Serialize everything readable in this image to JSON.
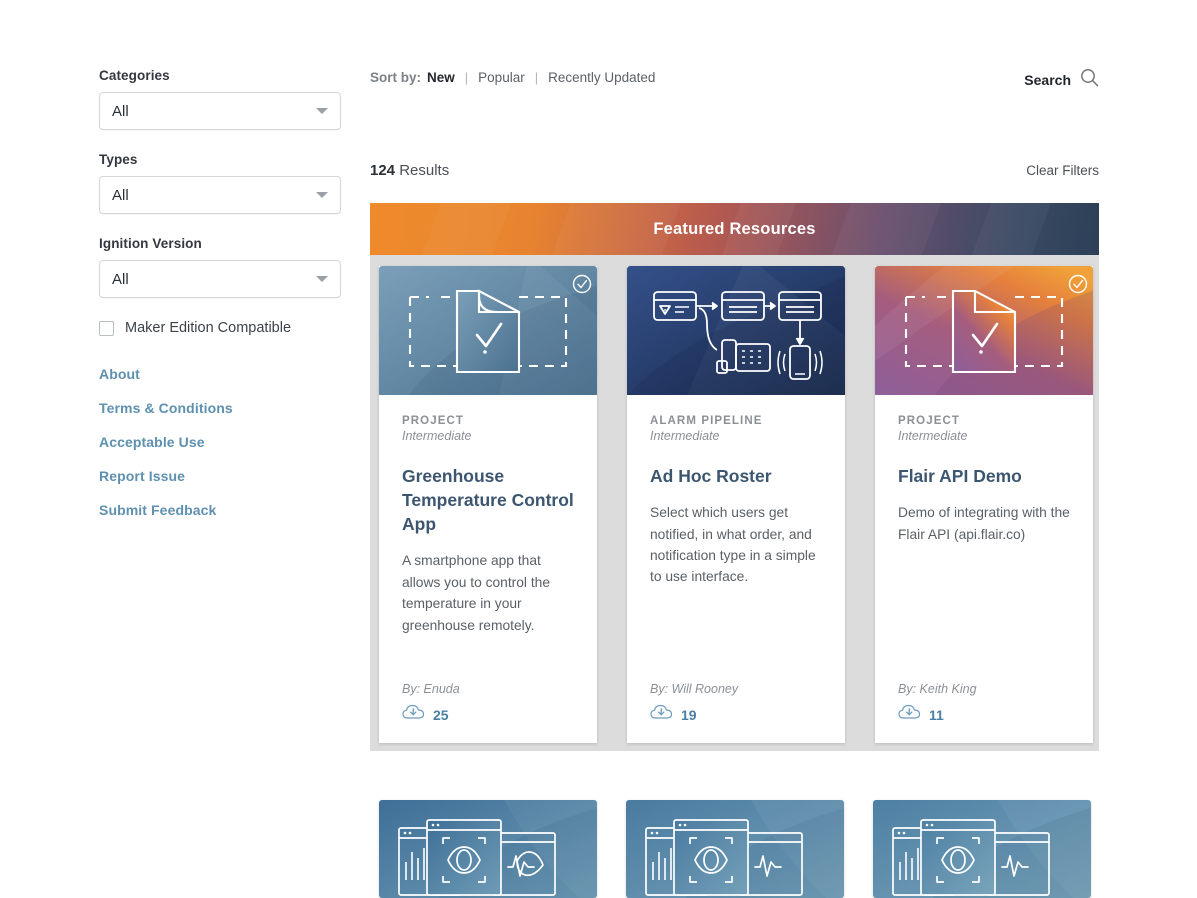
{
  "sidebar": {
    "filters": [
      {
        "label": "Categories",
        "value": "All",
        "name": "categories"
      },
      {
        "label": "Types",
        "value": "All",
        "name": "types"
      },
      {
        "label": "Ignition Version",
        "value": "All",
        "name": "ignition-version"
      }
    ],
    "checkbox": {
      "label": "Maker Edition Compatible",
      "checked": false
    },
    "links": [
      "About",
      "Terms & Conditions",
      "Acceptable Use",
      "Report Issue",
      "Submit Feedback"
    ],
    "link_color": "#5e90b0"
  },
  "toolbar": {
    "sort_label": "Sort by:",
    "sort_options": [
      {
        "label": "New",
        "active": true
      },
      {
        "label": "Popular",
        "active": false
      },
      {
        "label": "Recently Updated",
        "active": false
      }
    ],
    "separator": "|",
    "search_label": "Search",
    "search_icon": "search-icon"
  },
  "results": {
    "count": "124",
    "count_suffix": "Results",
    "clear_filters": "Clear Filters"
  },
  "featured": {
    "title": "Featured Resources",
    "gradient_from": "#ef8b2c",
    "gradient_to": "#2d4058",
    "panel_background": "#dcdcdc",
    "cards": [
      {
        "category": "PROJECT",
        "level": "Intermediate",
        "title": "Greenhouse Temperature Control App",
        "description": "A smartphone app that allows you to control the temperature in your greenhouse remotely.",
        "author": "By: Enuda",
        "downloads": "25",
        "download_icon": "cloud-download-icon",
        "verified": true,
        "verified_icon": "check-circle-icon",
        "thumbnail": "project-document-check",
        "thumb_color_a": "#6d95b0",
        "thumb_color_b": "#4d7390"
      },
      {
        "category": "ALARM PIPELINE",
        "level": "Intermediate",
        "title": "Ad Hoc Roster",
        "description": "Select which users get notified, in what order, and notification type in a simple to use interface.",
        "author": "By: Will Rooney",
        "downloads": "19",
        "download_icon": "cloud-download-icon",
        "verified": false,
        "verified_icon": "check-circle-icon",
        "thumbnail": "alarm-pipeline-flow",
        "thumb_color_a": "#2f4a7a",
        "thumb_color_b": "#1d3158"
      },
      {
        "category": "PROJECT",
        "level": "Intermediate",
        "title": "Flair API Demo",
        "description": "Demo of integrating with the Flair API (api.flair.co)",
        "author": "By: Keith King",
        "downloads": "11",
        "download_icon": "cloud-download-icon",
        "verified": true,
        "verified_icon": "check-circle-icon",
        "thumbnail": "project-document-check",
        "thumb_color_a": "#8a5b94",
        "thumb_color_b": "#e8833a"
      }
    ]
  },
  "bottom_row": {
    "cards": [
      {
        "thumbnail": "perspective-vision",
        "thumb_color_a": "#3f6f97",
        "thumb_color_b": "#5c8ba8"
      },
      {
        "thumbnail": "perspective-vision",
        "thumb_color_a": "#4a7ba0",
        "thumb_color_b": "#6394ae"
      },
      {
        "thumbnail": "perspective-vision",
        "thumb_color_a": "#4e80a4",
        "thumb_color_b": "#6b9ab3"
      }
    ]
  }
}
